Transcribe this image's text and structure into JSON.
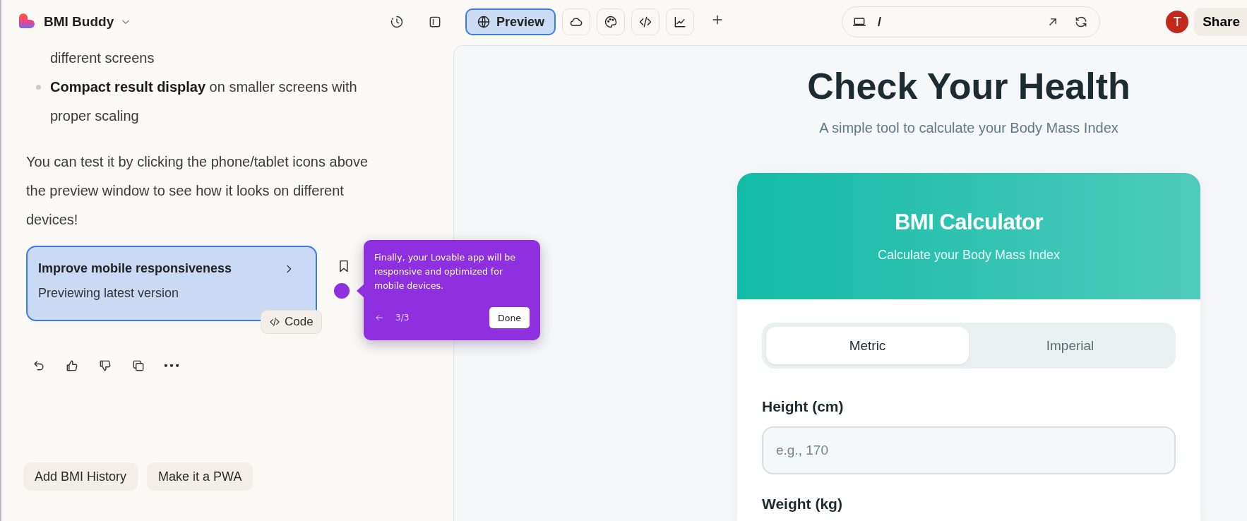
{
  "project": {
    "name": "BMI Buddy"
  },
  "view_tabs": [
    {
      "kind": "preview",
      "label": "Preview",
      "selected": true
    },
    {
      "kind": "cloud",
      "selected": false
    },
    {
      "kind": "palette",
      "selected": false
    },
    {
      "kind": "code",
      "selected": false
    },
    {
      "kind": "chart",
      "selected": false
    }
  ],
  "url_bar": {
    "path": "/"
  },
  "user": {
    "initial": "T"
  },
  "share_label": "Share",
  "chat": {
    "items": [
      {
        "kind": "continuation",
        "text": "different screens"
      },
      {
        "kind": "bullet",
        "text": "**Compact result display** on smaller screens with proper scaling"
      }
    ],
    "paragraph": "You can test it by clicking the phone/tablet icons above the preview window to see how it looks on different devices!",
    "version_card": {
      "title": "Improve mobile responsiveness",
      "subtitle": "Previewing latest version",
      "code_label": "Code",
      "selected": true
    },
    "tour": {
      "text": "Finally, your Lovable app will be responsive and optimized for mobile devices.",
      "step": "3/3",
      "done_label": "Done"
    },
    "suggestions": [
      "Add BMI History",
      "Make it a PWA"
    ]
  },
  "preview": {
    "heading": "Check Your Health",
    "subheading": "A simple tool to calculate your Body Mass Index",
    "card": {
      "title": "BMI Calculator",
      "subtitle": "Calculate your Body Mass Index",
      "units": [
        {
          "label": "Metric",
          "selected": true
        },
        {
          "label": "Imperial",
          "selected": false
        }
      ],
      "fields": [
        {
          "label": "Height (cm)",
          "placeholder": "e.g., 170"
        },
        {
          "label": "Weight (kg)"
        }
      ]
    }
  }
}
